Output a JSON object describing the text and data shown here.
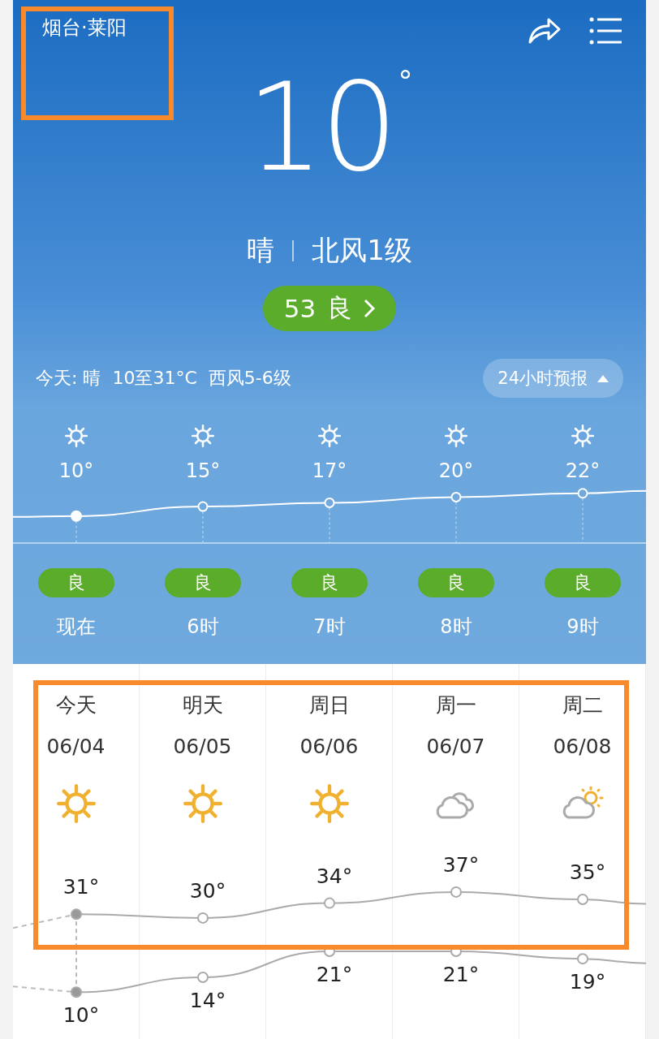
{
  "location": "烟台·莱阳",
  "current": {
    "temperature": "10",
    "degree": "°",
    "condition": "晴",
    "wind": "北风1级",
    "aqi": {
      "value": "53",
      "level": "良"
    }
  },
  "today_summary": "今天: 晴  10至31°C  西风5-6级",
  "forecast_toggle": {
    "label": "24小时预报",
    "expanded": true
  },
  "hourly": [
    {
      "temperature": "10°",
      "air_quality": "良",
      "time": "现在",
      "current": true
    },
    {
      "temperature": "15°",
      "air_quality": "良",
      "time": "6时",
      "current": false
    },
    {
      "temperature": "17°",
      "air_quality": "良",
      "time": "7时",
      "current": false
    },
    {
      "temperature": "20°",
      "air_quality": "良",
      "time": "8时",
      "current": false
    },
    {
      "temperature": "22°",
      "air_quality": "良",
      "time": "9时",
      "current": false
    }
  ],
  "daily": [
    {
      "day": "今天",
      "date": "06/04",
      "kind": "sunny",
      "high": "31°",
      "low": "10°",
      "current": true
    },
    {
      "day": "明天",
      "date": "06/05",
      "kind": "sunny",
      "high": "30°",
      "low": "14°",
      "current": false
    },
    {
      "day": "周日",
      "date": "06/06",
      "kind": "sunny",
      "high": "34°",
      "low": "21°",
      "current": false
    },
    {
      "day": "周一",
      "date": "06/07",
      "kind": "cloudy",
      "high": "37°",
      "low": "21°",
      "current": false
    },
    {
      "day": "周二",
      "date": "06/08",
      "kind": "partly",
      "high": "35°",
      "low": "19°",
      "current": false
    }
  ]
}
